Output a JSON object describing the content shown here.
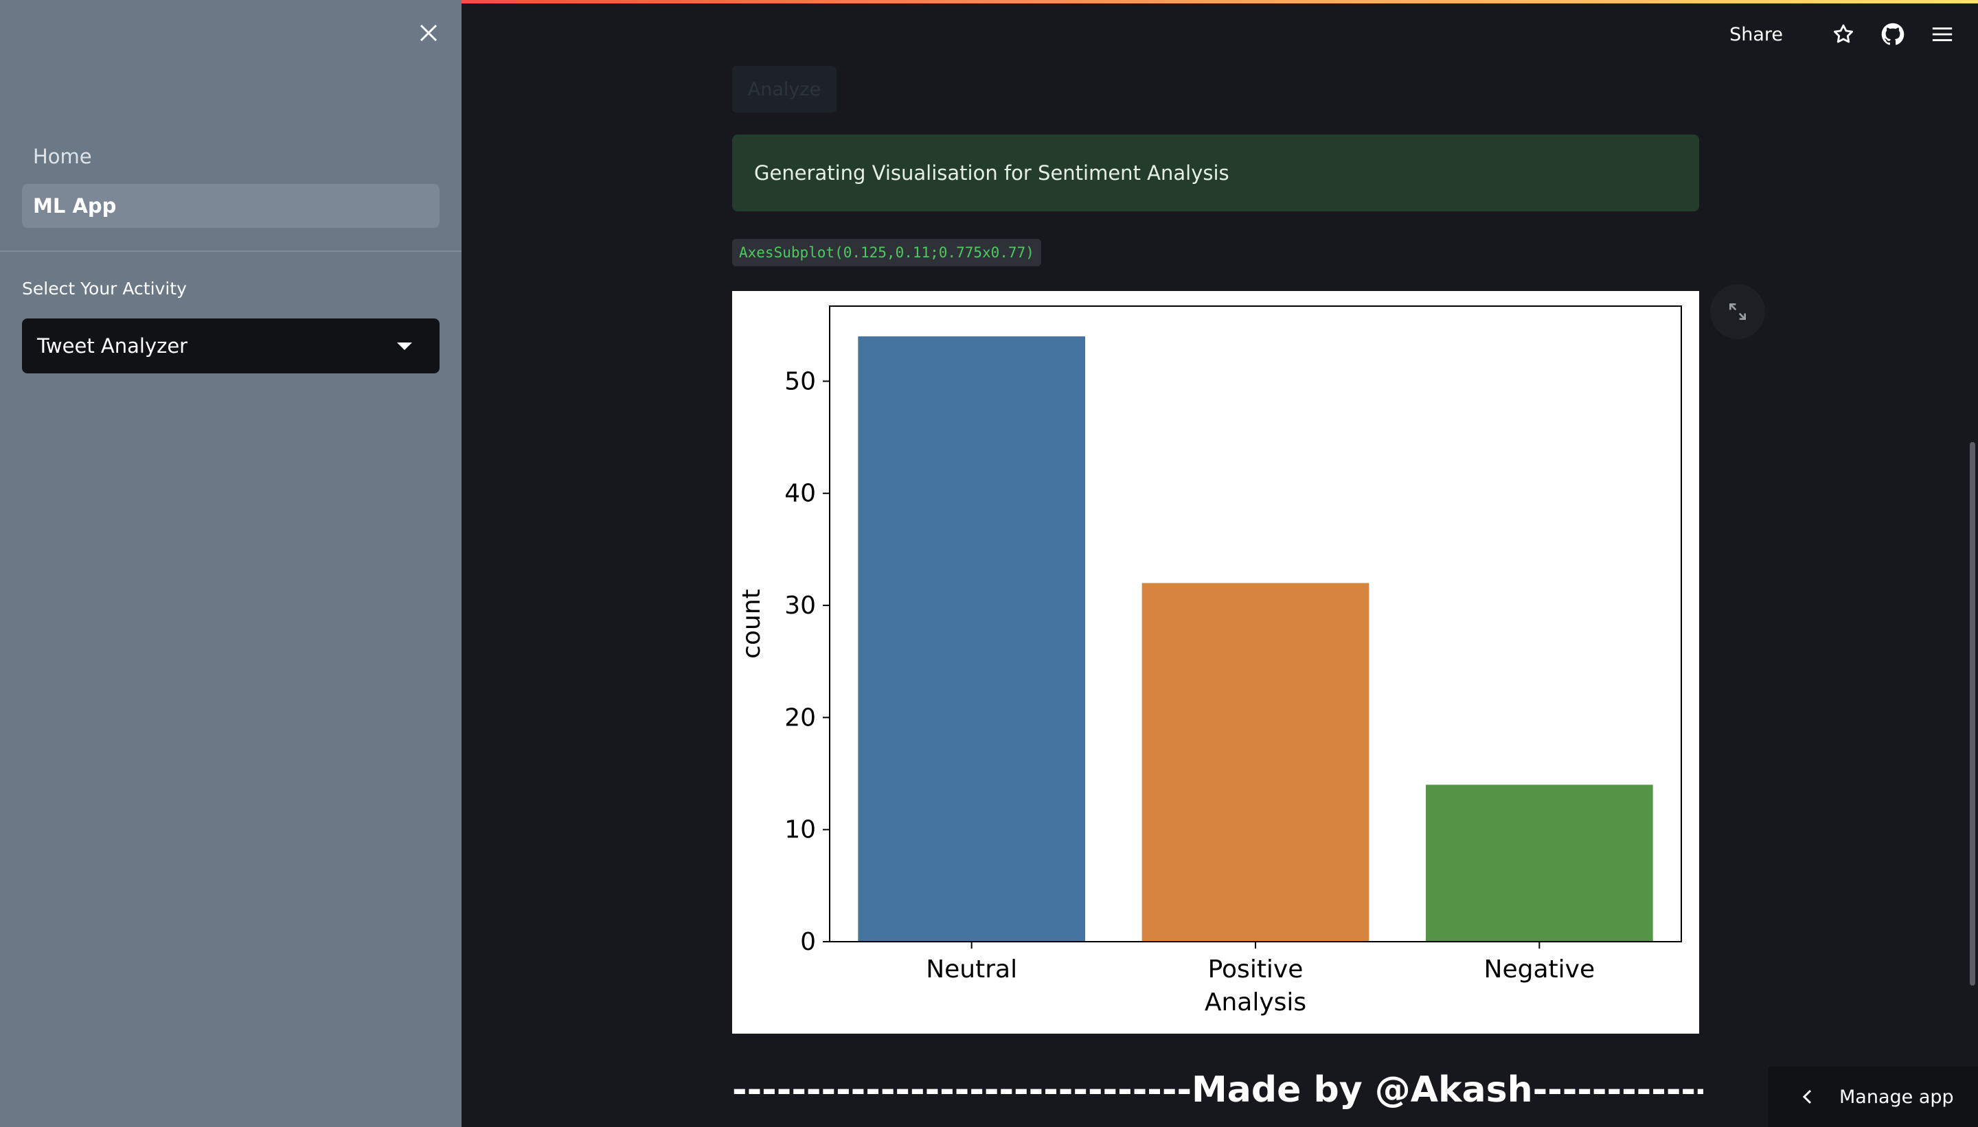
{
  "sidebar": {
    "nav": [
      {
        "label": "Home"
      },
      {
        "label": "ML App"
      }
    ],
    "select_label": "Select Your Activity",
    "select_value": "Tweet Analyzer"
  },
  "toolbar": {
    "share_label": "Share",
    "icons": [
      "star-icon",
      "github-icon",
      "hamburger-menu-icon"
    ]
  },
  "main": {
    "analyze_button": "Analyze",
    "alert_text": "Generating Visualisation for Sentiment Analysis",
    "code_output": "AxesSubplot(0.125,0.11;0.775x0.77)",
    "footer_text": "-------------------------------Made by @Akash-------------------------"
  },
  "manage_app": {
    "label": "Manage app"
  },
  "colors": {
    "sidebar_bg": "#6b7886",
    "main_bg": "#16181d",
    "alert_bg": "#243c2c",
    "code_text": "#4fc95f"
  },
  "chart_data": {
    "type": "bar",
    "categories": [
      "Neutral",
      "Positive",
      "Negative"
    ],
    "values": [
      54,
      32,
      14
    ],
    "colors": [
      "#4674a1",
      "#d5853f",
      "#549444"
    ],
    "xlabel": "Analysis",
    "ylabel": "count",
    "yticks": [
      0,
      10,
      20,
      30,
      40,
      50
    ],
    "ylim": [
      0,
      56.7
    ],
    "grid": false
  }
}
